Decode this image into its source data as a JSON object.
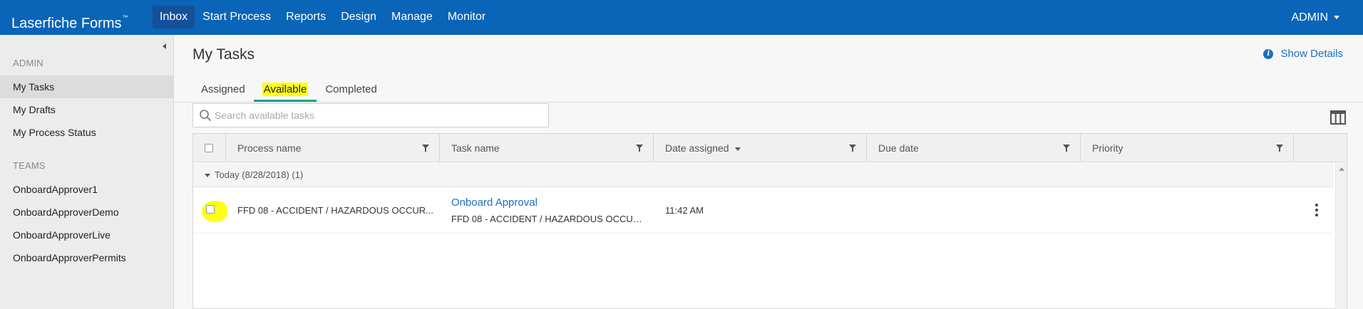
{
  "topbar": {
    "brand": "Laserfiche Forms",
    "brand_tm": "™",
    "nav": [
      "Inbox",
      "Start Process",
      "Reports",
      "Design",
      "Manage",
      "Monitor"
    ],
    "active_nav": "Inbox",
    "user_menu": "ADMIN"
  },
  "sidebar": {
    "user_header": "ADMIN",
    "user_items": [
      "My Tasks",
      "My Drafts",
      "My Process Status"
    ],
    "active_item": "My Tasks",
    "teams_header": "TEAMS",
    "team_items": [
      "OnboardApprover1",
      "OnboardApproverDemo",
      "OnboardApproverLive",
      "OnboardApproverPermits"
    ]
  },
  "main": {
    "title": "My Tasks",
    "show_details": "Show Details",
    "tabs": [
      "Assigned",
      "Available",
      "Completed"
    ],
    "active_tab": "Available",
    "search_placeholder": "Search available tasks"
  },
  "table": {
    "columns": [
      "Process name",
      "Task name",
      "Date assigned",
      "Due date",
      "Priority"
    ],
    "group_label": "Today (8/28/2018) (1)",
    "rows": [
      {
        "process_name": "FFD 08 - ACCIDENT / HAZARDOUS OCCUR...",
        "task_name": "Onboard Approval",
        "task_sub": "FFD 08 - ACCIDENT / HAZARDOUS OCCURRE...",
        "date_assigned": "11:42 AM",
        "due_date": "",
        "priority": ""
      }
    ]
  },
  "colors": {
    "topbar": "#0a64b7",
    "accent": "#1a6fc2",
    "tab_underline": "#17a589",
    "highlight": "#ffff1a"
  },
  "icons": [
    "caret-down-icon",
    "collapse-left-icon",
    "info-icon",
    "search-icon",
    "columns-icon",
    "filter-icon",
    "kebab-menu-icon"
  ]
}
